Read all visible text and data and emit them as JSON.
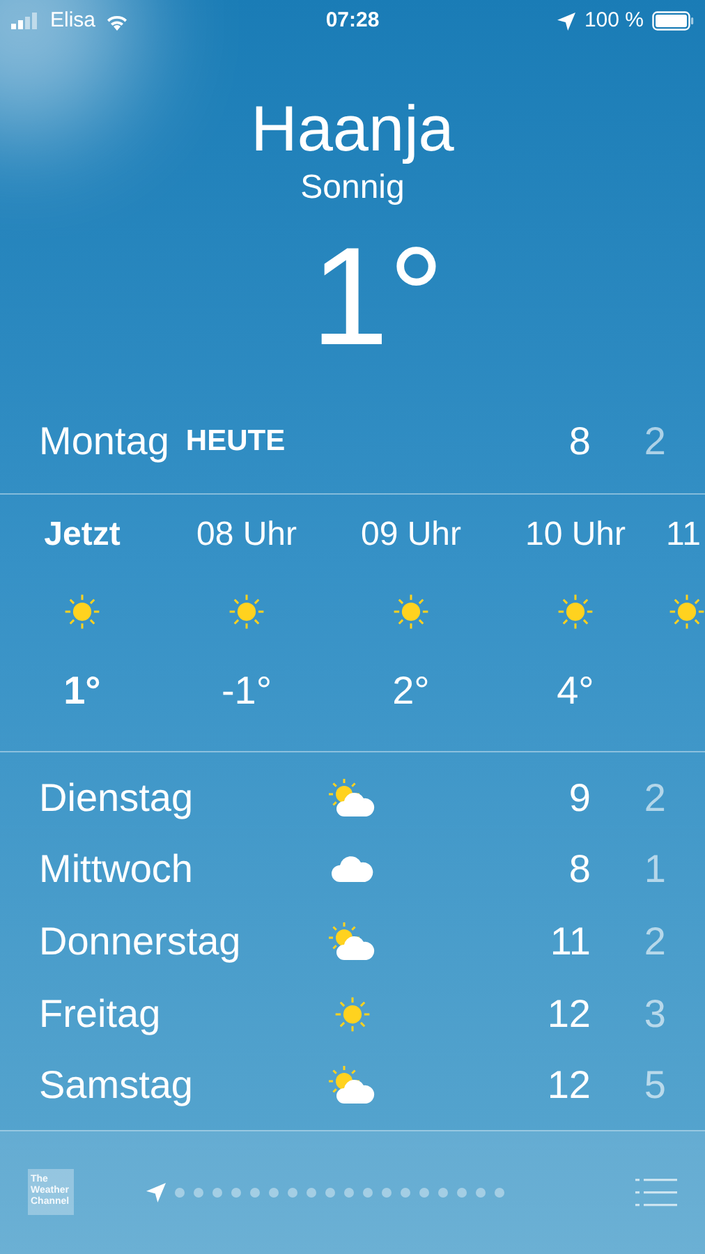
{
  "status_bar": {
    "carrier": "Elisa",
    "time": "07:28",
    "battery": "100 %"
  },
  "location": {
    "city": "Haanja",
    "condition": "Sonnig",
    "temperature": "1°"
  },
  "today": {
    "day": "Montag",
    "label": "HEUTE",
    "high": "8",
    "low": "2"
  },
  "hourly": [
    {
      "time": "Jetzt",
      "kind": "sun",
      "temperature": "1°",
      "selected": true
    },
    {
      "time": "08 Uhr",
      "kind": "sun",
      "temperature": "-1°",
      "selected": false
    },
    {
      "time": "09 Uhr",
      "kind": "sun",
      "temperature": "2°",
      "selected": false
    },
    {
      "time": "10 Uhr",
      "kind": "sun",
      "temperature": "4°",
      "selected": false
    },
    {
      "time": "11",
      "kind": "sun",
      "selected": false
    }
  ],
  "daily": [
    {
      "day": "Dienstag",
      "kind": "partly-cloudy",
      "high": "9",
      "low": "2"
    },
    {
      "day": "Mittwoch",
      "kind": "cloud",
      "high": "8",
      "low": "1"
    },
    {
      "day": "Donnerstag",
      "kind": "partly-cloudy",
      "high": "11",
      "low": "2"
    },
    {
      "day": "Freitag",
      "kind": "sun",
      "high": "12",
      "low": "3"
    },
    {
      "day": "Samstag",
      "kind": "partly-cloudy",
      "high": "12",
      "low": "5"
    }
  ],
  "footer": {
    "logo": "The Weather Channel"
  }
}
